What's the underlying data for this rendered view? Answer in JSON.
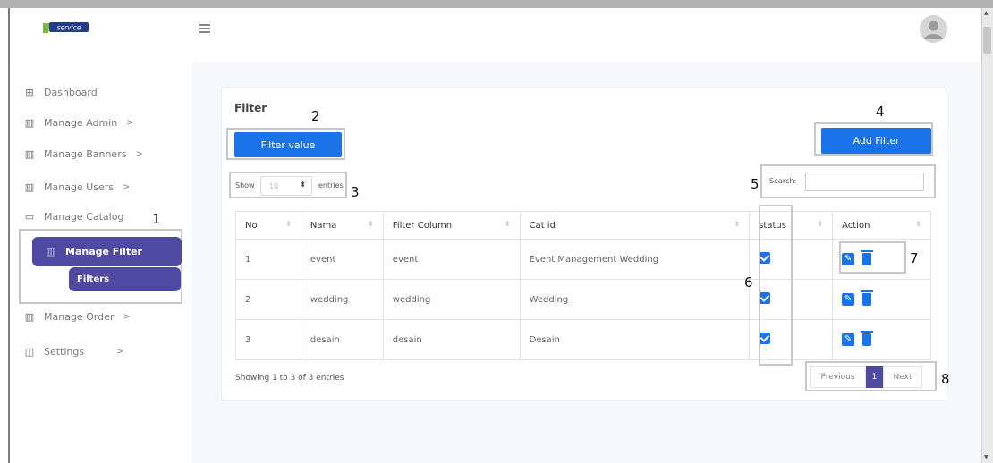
{
  "app": {
    "logo_text": "service"
  },
  "sidebar": {
    "items": [
      {
        "label": "Dashboard",
        "icon": "grid-icon"
      },
      {
        "label": "Manage Admin",
        "chevron": ">",
        "icon": "table-icon"
      },
      {
        "label": "Manage Banners",
        "chevron": ">",
        "icon": "table-icon"
      },
      {
        "label": "Manage Users",
        "chevron": ">",
        "icon": "table-icon"
      },
      {
        "label": "Manage Catalog",
        "icon": "box-icon"
      },
      {
        "label": "Manage Filter",
        "icon": "table-icon"
      },
      {
        "label": "Filters"
      },
      {
        "label": "Manage Order",
        "chevron": ">",
        "icon": "table-icon"
      },
      {
        "label": "Settings",
        "chevron": ">",
        "icon": "settings-box-icon"
      }
    ]
  },
  "card": {
    "title": "Filter",
    "filter_value_button": "Filter value",
    "add_filter_button": "Add Filter",
    "show_label": "Show",
    "entries_value": "10",
    "entries_label": "entries",
    "search_label": "Search:",
    "search_value": ""
  },
  "table": {
    "columns": [
      "No",
      "Nama",
      "Filter Column",
      "Cat id",
      "status",
      "Action"
    ],
    "rows": [
      {
        "no": "1",
        "nama": "event",
        "filter_column": "event",
        "cat_id": "Event Management Wedding",
        "status": true
      },
      {
        "no": "2",
        "nama": "wedding",
        "filter_column": "wedding",
        "cat_id": "Wedding",
        "status": true
      },
      {
        "no": "3",
        "nama": "desain",
        "filter_column": "desain",
        "cat_id": "Desain",
        "status": true
      }
    ]
  },
  "footer": {
    "showing_text": "Showing 1 to 3 of 3 entries",
    "previous": "Previous",
    "current_page": "1",
    "next": "Next"
  },
  "annotations": {
    "a1": "1",
    "a2": "2",
    "a3": "3",
    "a4": "4",
    "a5": "5",
    "a6": "6",
    "a7": "7",
    "a8": "8"
  },
  "colors": {
    "primary": "#1a73e8",
    "sidebar_active": "#4f4aa1"
  }
}
